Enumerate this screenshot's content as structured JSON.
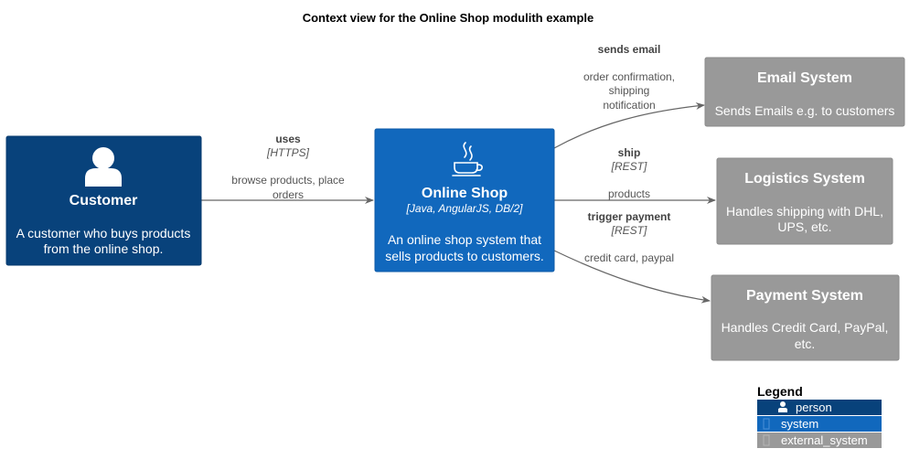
{
  "title": "Context view for the Online Shop modulith example",
  "colors": {
    "person": "#08427B",
    "system": "#1168BD",
    "external_system": "#999999",
    "edge": "#666666"
  },
  "nodes": {
    "customer": {
      "icon": "person-icon",
      "title": "Customer",
      "desc": [
        "A customer who buys products",
        "from the online shop."
      ]
    },
    "online_shop": {
      "icon": "java-icon",
      "title": "Online Shop",
      "tech": "[Java, AngularJS, DB/2]",
      "desc": [
        "An online shop system that",
        "sells products to customers."
      ]
    },
    "email": {
      "title": "Email System",
      "desc": [
        "Sends Emails e.g. to customers"
      ]
    },
    "logistics": {
      "title": "Logistics System",
      "desc": [
        "Handles shipping with DHL,",
        "UPS, etc."
      ]
    },
    "payment": {
      "title": "Payment System",
      "desc": [
        "Handles Credit Card, PayPal,",
        "etc."
      ]
    }
  },
  "relations": {
    "uses": {
      "label": "uses",
      "tech": "[HTTPS]",
      "desc": [
        "browse products, place",
        "orders"
      ]
    },
    "sends_email": {
      "label": "sends email",
      "desc": [
        "order confirmation,",
        "shipping",
        "notification"
      ]
    },
    "ship": {
      "label": "ship",
      "tech": "[REST]",
      "desc": [
        "products"
      ]
    },
    "trigger_payment": {
      "label": "trigger payment",
      "tech": "[REST]",
      "desc": [
        "credit card, paypal"
      ]
    }
  },
  "legend": {
    "title": "Legend",
    "items": [
      {
        "label": "person",
        "icon": "person-icon"
      },
      {
        "label": "system"
      },
      {
        "label": "external_system"
      }
    ]
  }
}
